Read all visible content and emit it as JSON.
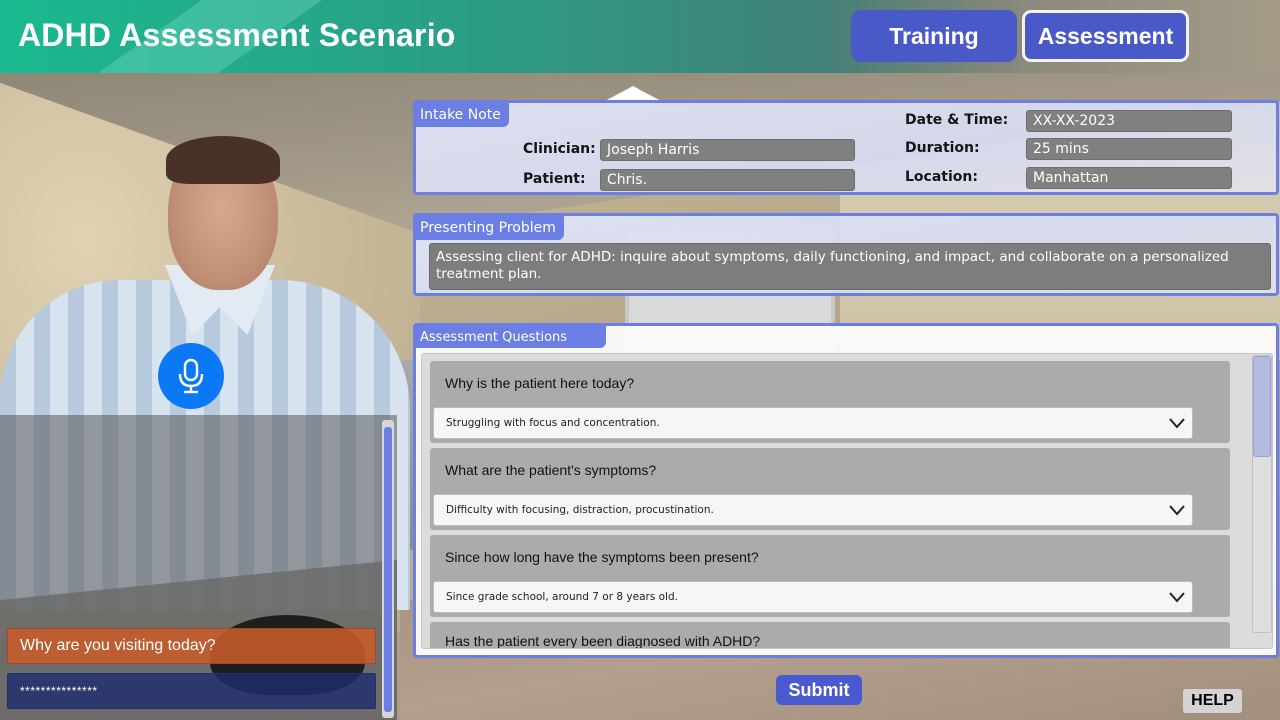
{
  "header": {
    "title": "ADHD Assessment Scenario",
    "modes": [
      {
        "label": "Training",
        "active": false
      },
      {
        "label": "Assessment",
        "active": true
      }
    ]
  },
  "intake_note": {
    "heading": "Intake Note",
    "fields": {
      "clinician": {
        "label": "Clinician:",
        "value": "Joseph Harris"
      },
      "patient": {
        "label": "Patient:",
        "value": "Chris."
      },
      "date_time": {
        "label": "Date & Time:",
        "value": "XX-XX-2023"
      },
      "duration": {
        "label": "Duration:",
        "value": "25 mins"
      },
      "location": {
        "label": "Location:",
        "value": "Manhattan"
      }
    }
  },
  "presenting_problem": {
    "heading": "Presenting Problem",
    "text": "Assessing client for ADHD: inquire about symptoms, daily functioning, and impact, and collaborate on a personalized treatment plan."
  },
  "assessment_questions": {
    "heading": "Assessment Questions",
    "items": [
      {
        "question": "Why is the patient here today?",
        "selected": "Struggling with focus and concentration.",
        "icon": "chevron-down-icon"
      },
      {
        "question": "What are the patient's symptoms?",
        "selected": "Difficulty with focusing, distraction, procustination.",
        "icon": "chevron-down-icon"
      },
      {
        "question": "Since how long have the symptoms been present?",
        "selected": "Since grade school, around 7 or 8 years old.",
        "icon": "chevron-down-icon"
      },
      {
        "question": "Has the patient every been diagnosed with ADHD?",
        "selected": "",
        "icon": "chevron-down-icon"
      }
    ],
    "scroll_position_fraction": 0.0
  },
  "chat": {
    "prompt": "Why are you visiting today?",
    "response_masked": "***************",
    "mic_icon": "microphone-icon"
  },
  "actions": {
    "submit_label": "Submit",
    "help_label": "HELP"
  }
}
